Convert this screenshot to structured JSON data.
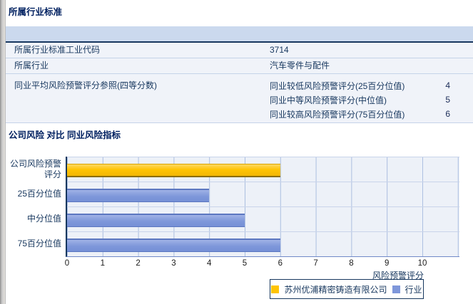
{
  "industry_section": {
    "title": "所属行业标准",
    "rows": [
      {
        "label": "所属行业标准工业代码",
        "value": "3714"
      },
      {
        "label": "所属行业",
        "value": "汽车零件与配件"
      }
    ],
    "peer_row": {
      "label": "同业平均风险预警评分参照(四等分数)",
      "items": [
        {
          "label": "同业较低风险预警评分(25百分位值)",
          "value": "4"
        },
        {
          "label": "同业中等风险预警评分(中位值)",
          "value": "5"
        },
        {
          "label": "同业较高风险预警评分(75百分位值)",
          "value": "6"
        }
      ]
    }
  },
  "chart_section": {
    "title": "公司风险 对比 同业风险指标"
  },
  "chart_data": {
    "type": "bar",
    "orientation": "horizontal",
    "title": "公司风险 对比 同业风险指标",
    "categories": [
      "公司风险预警评分",
      "25百分位值",
      "中分位值",
      "75百分位值"
    ],
    "values": [
      6,
      4,
      5,
      6
    ],
    "category_series": [
      "company",
      "industry",
      "industry",
      "industry"
    ],
    "series": [
      {
        "key": "company",
        "name": "苏州优浦精密铸造有限公司",
        "color": "#FFC405"
      },
      {
        "key": "industry",
        "name": "行业",
        "color": "#7E97DA"
      }
    ],
    "xlabel": "风险预警评分",
    "xlim": [
      0,
      11
    ],
    "xticks": [
      0,
      1,
      2,
      3,
      4,
      5,
      6,
      7,
      8,
      9,
      10
    ],
    "grid": true,
    "legend_position": "bottom"
  },
  "colors": {
    "title_text": "#002060",
    "body_text": "#17375E",
    "table_header_band": "#CBD9EE",
    "table_row_bg": "#F0F3F9",
    "row_separator": "#C5D3E8",
    "plot_bg": "#EDF1F8",
    "gridline": "#ABBEE0",
    "axis": "#17375E",
    "company_bar": "#FFC405",
    "industry_bar": "#7E97DA"
  }
}
